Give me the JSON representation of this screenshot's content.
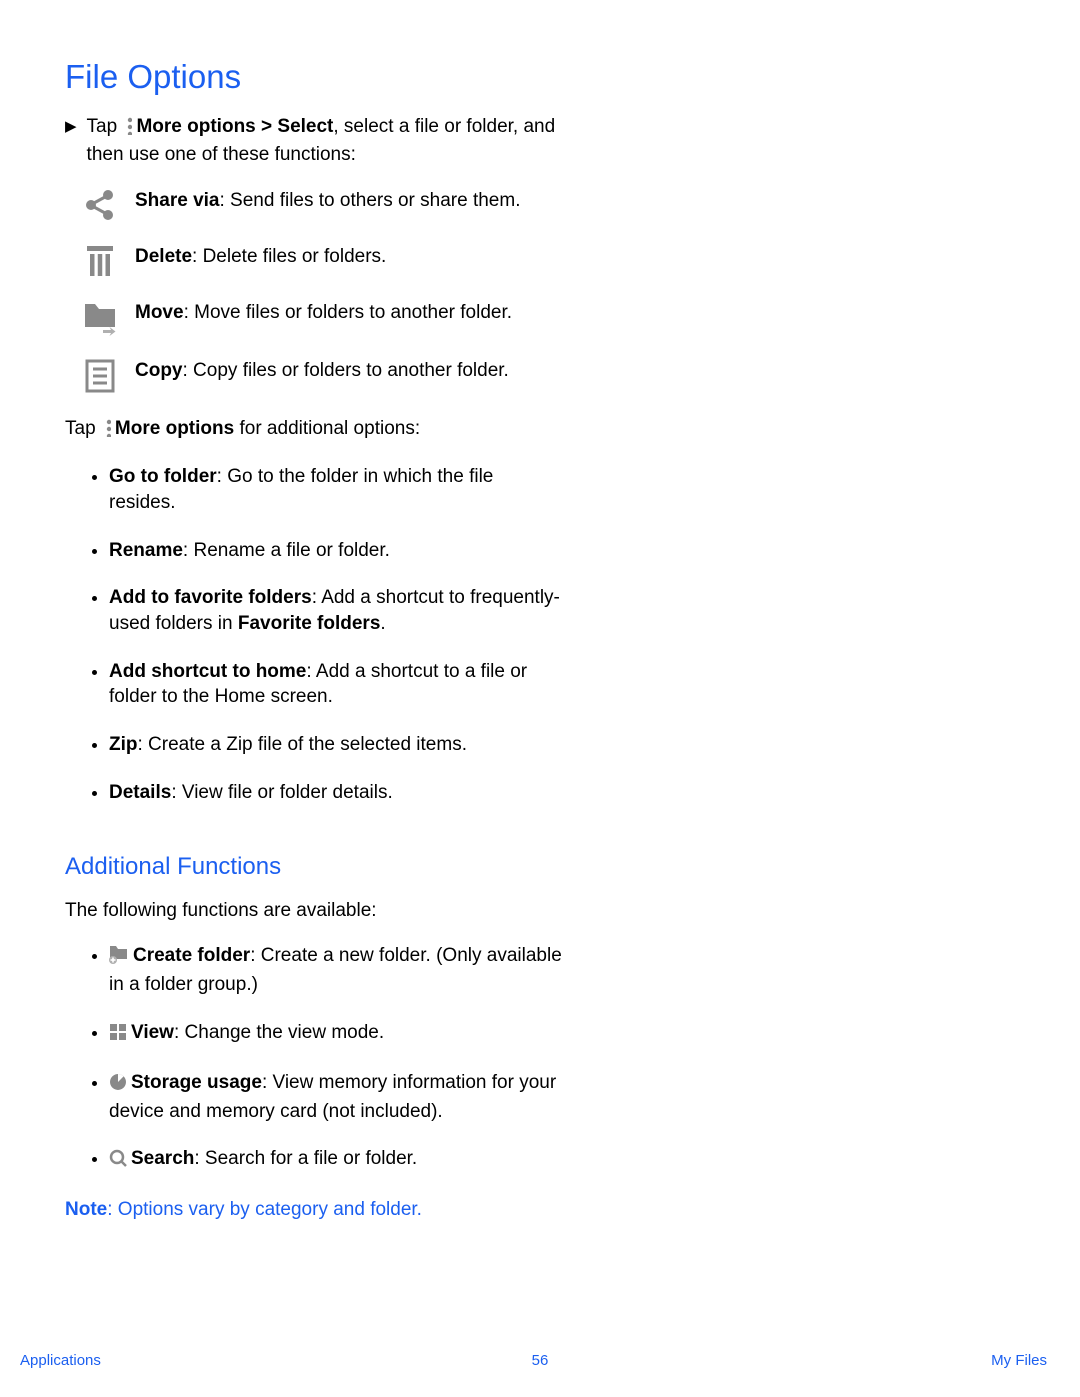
{
  "h1": "File Options",
  "intro": {
    "pre": "Tap ",
    "bold": "More options > Select",
    "post": ", select a file or folder, and then use one of these functions:"
  },
  "mainActions": [
    {
      "name": "share",
      "label": "Share via",
      "desc": ": Send files to others or share them."
    },
    {
      "name": "delete",
      "label": "Delete",
      "desc": ": Delete files or folders."
    },
    {
      "name": "move",
      "label": "Move",
      "desc": ": Move files or folders to another folder."
    },
    {
      "name": "copy",
      "label": "Copy",
      "desc": ": Copy files or folders to another folder."
    }
  ],
  "tapMore": {
    "pre": "Tap ",
    "bold": "More options",
    "post": " for additional options:"
  },
  "moreOptions": [
    {
      "label": "Go to folder",
      "desc": ": Go to the folder in which the file resides."
    },
    {
      "label": "Rename",
      "desc": ": Rename a file or folder."
    },
    {
      "label": "Add to favorite folders",
      "desc_pre": ": Add a shortcut to frequently-used folders in ",
      "desc_bold": "Favorite folders",
      "desc_post": "."
    },
    {
      "label": "Add shortcut to home",
      "desc": ": Add a shortcut to a file or folder to the Home screen."
    },
    {
      "label": "Zip",
      "desc": ": Create a Zip file of the selected items."
    },
    {
      "label": "Details",
      "desc": ": View file or folder details."
    }
  ],
  "h2": "Additional Functions",
  "h2_intro": "The following functions are available:",
  "additional": [
    {
      "name": "create-folder",
      "label": "Create folder",
      "desc": ": Create a new folder. (Only available in a folder group.)"
    },
    {
      "name": "view",
      "label": "View",
      "desc": ": Change the view mode."
    },
    {
      "name": "storage-usage",
      "label": "Storage usage",
      "desc": ": View memory information for your device and memory card (not included)."
    },
    {
      "name": "search",
      "label": "Search",
      "desc": ": Search for a file or folder."
    }
  ],
  "note": {
    "bold": "Note",
    "rest": ": Options vary by category and folder."
  },
  "footer": {
    "left": "Applications",
    "center": "56",
    "right": "My Files"
  }
}
